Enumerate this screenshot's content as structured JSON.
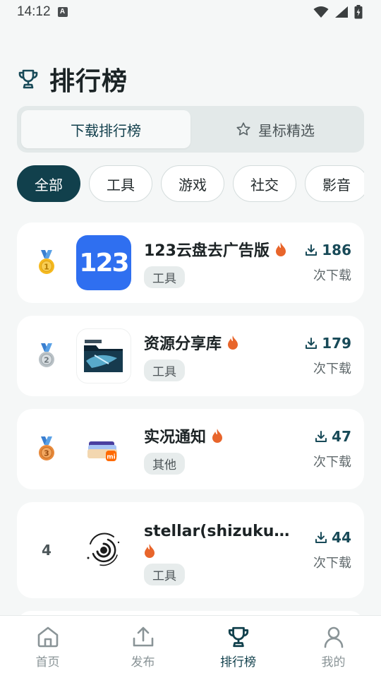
{
  "status_bar": {
    "time": "14:12"
  },
  "header": {
    "title": "排行榜",
    "icon": "trophy-icon"
  },
  "segment": {
    "tabs": [
      {
        "label": "下载排行榜",
        "active": true
      },
      {
        "label": "星标精选",
        "active": false,
        "icon": "star-icon"
      }
    ]
  },
  "chips": [
    {
      "label": "全部",
      "active": true
    },
    {
      "label": "工具",
      "active": false
    },
    {
      "label": "游戏",
      "active": false
    },
    {
      "label": "社交",
      "active": false
    },
    {
      "label": "影音",
      "active": false
    }
  ],
  "apps": [
    {
      "rank": "1",
      "medal": "gold-medal-icon",
      "name": "123云盘去广告版",
      "hot": true,
      "tag": "工具",
      "downloads": "186",
      "downloads_label": "次下载",
      "icon": "123-cloud-icon"
    },
    {
      "rank": "2",
      "medal": "silver-medal-icon",
      "name": "资源分享库",
      "hot": true,
      "tag": "工具",
      "downloads": "179",
      "downloads_label": "次下载",
      "icon": "folder-share-icon"
    },
    {
      "rank": "3",
      "medal": "bronze-medal-icon",
      "name": "实况通知",
      "hot": true,
      "tag": "其他",
      "downloads": "47",
      "downloads_label": "次下载",
      "icon": "live-notify-icon"
    },
    {
      "rank": "4",
      "medal": null,
      "name": "stellar(shizuku增强...",
      "hot": true,
      "tag": "工具",
      "downloads": "44",
      "downloads_label": "次下载",
      "icon": "spiral-galaxy-icon"
    }
  ],
  "bottom_nav": [
    {
      "label": "首页",
      "icon": "home-icon",
      "active": false
    },
    {
      "label": "发布",
      "icon": "upload-icon",
      "active": false
    },
    {
      "label": "排行榜",
      "icon": "trophy-icon",
      "active": true
    },
    {
      "label": "我的",
      "icon": "user-icon",
      "active": false
    }
  ],
  "colors": {
    "accent": "#11404c",
    "background": "#f5f7f7",
    "hot": "#e8652b"
  }
}
